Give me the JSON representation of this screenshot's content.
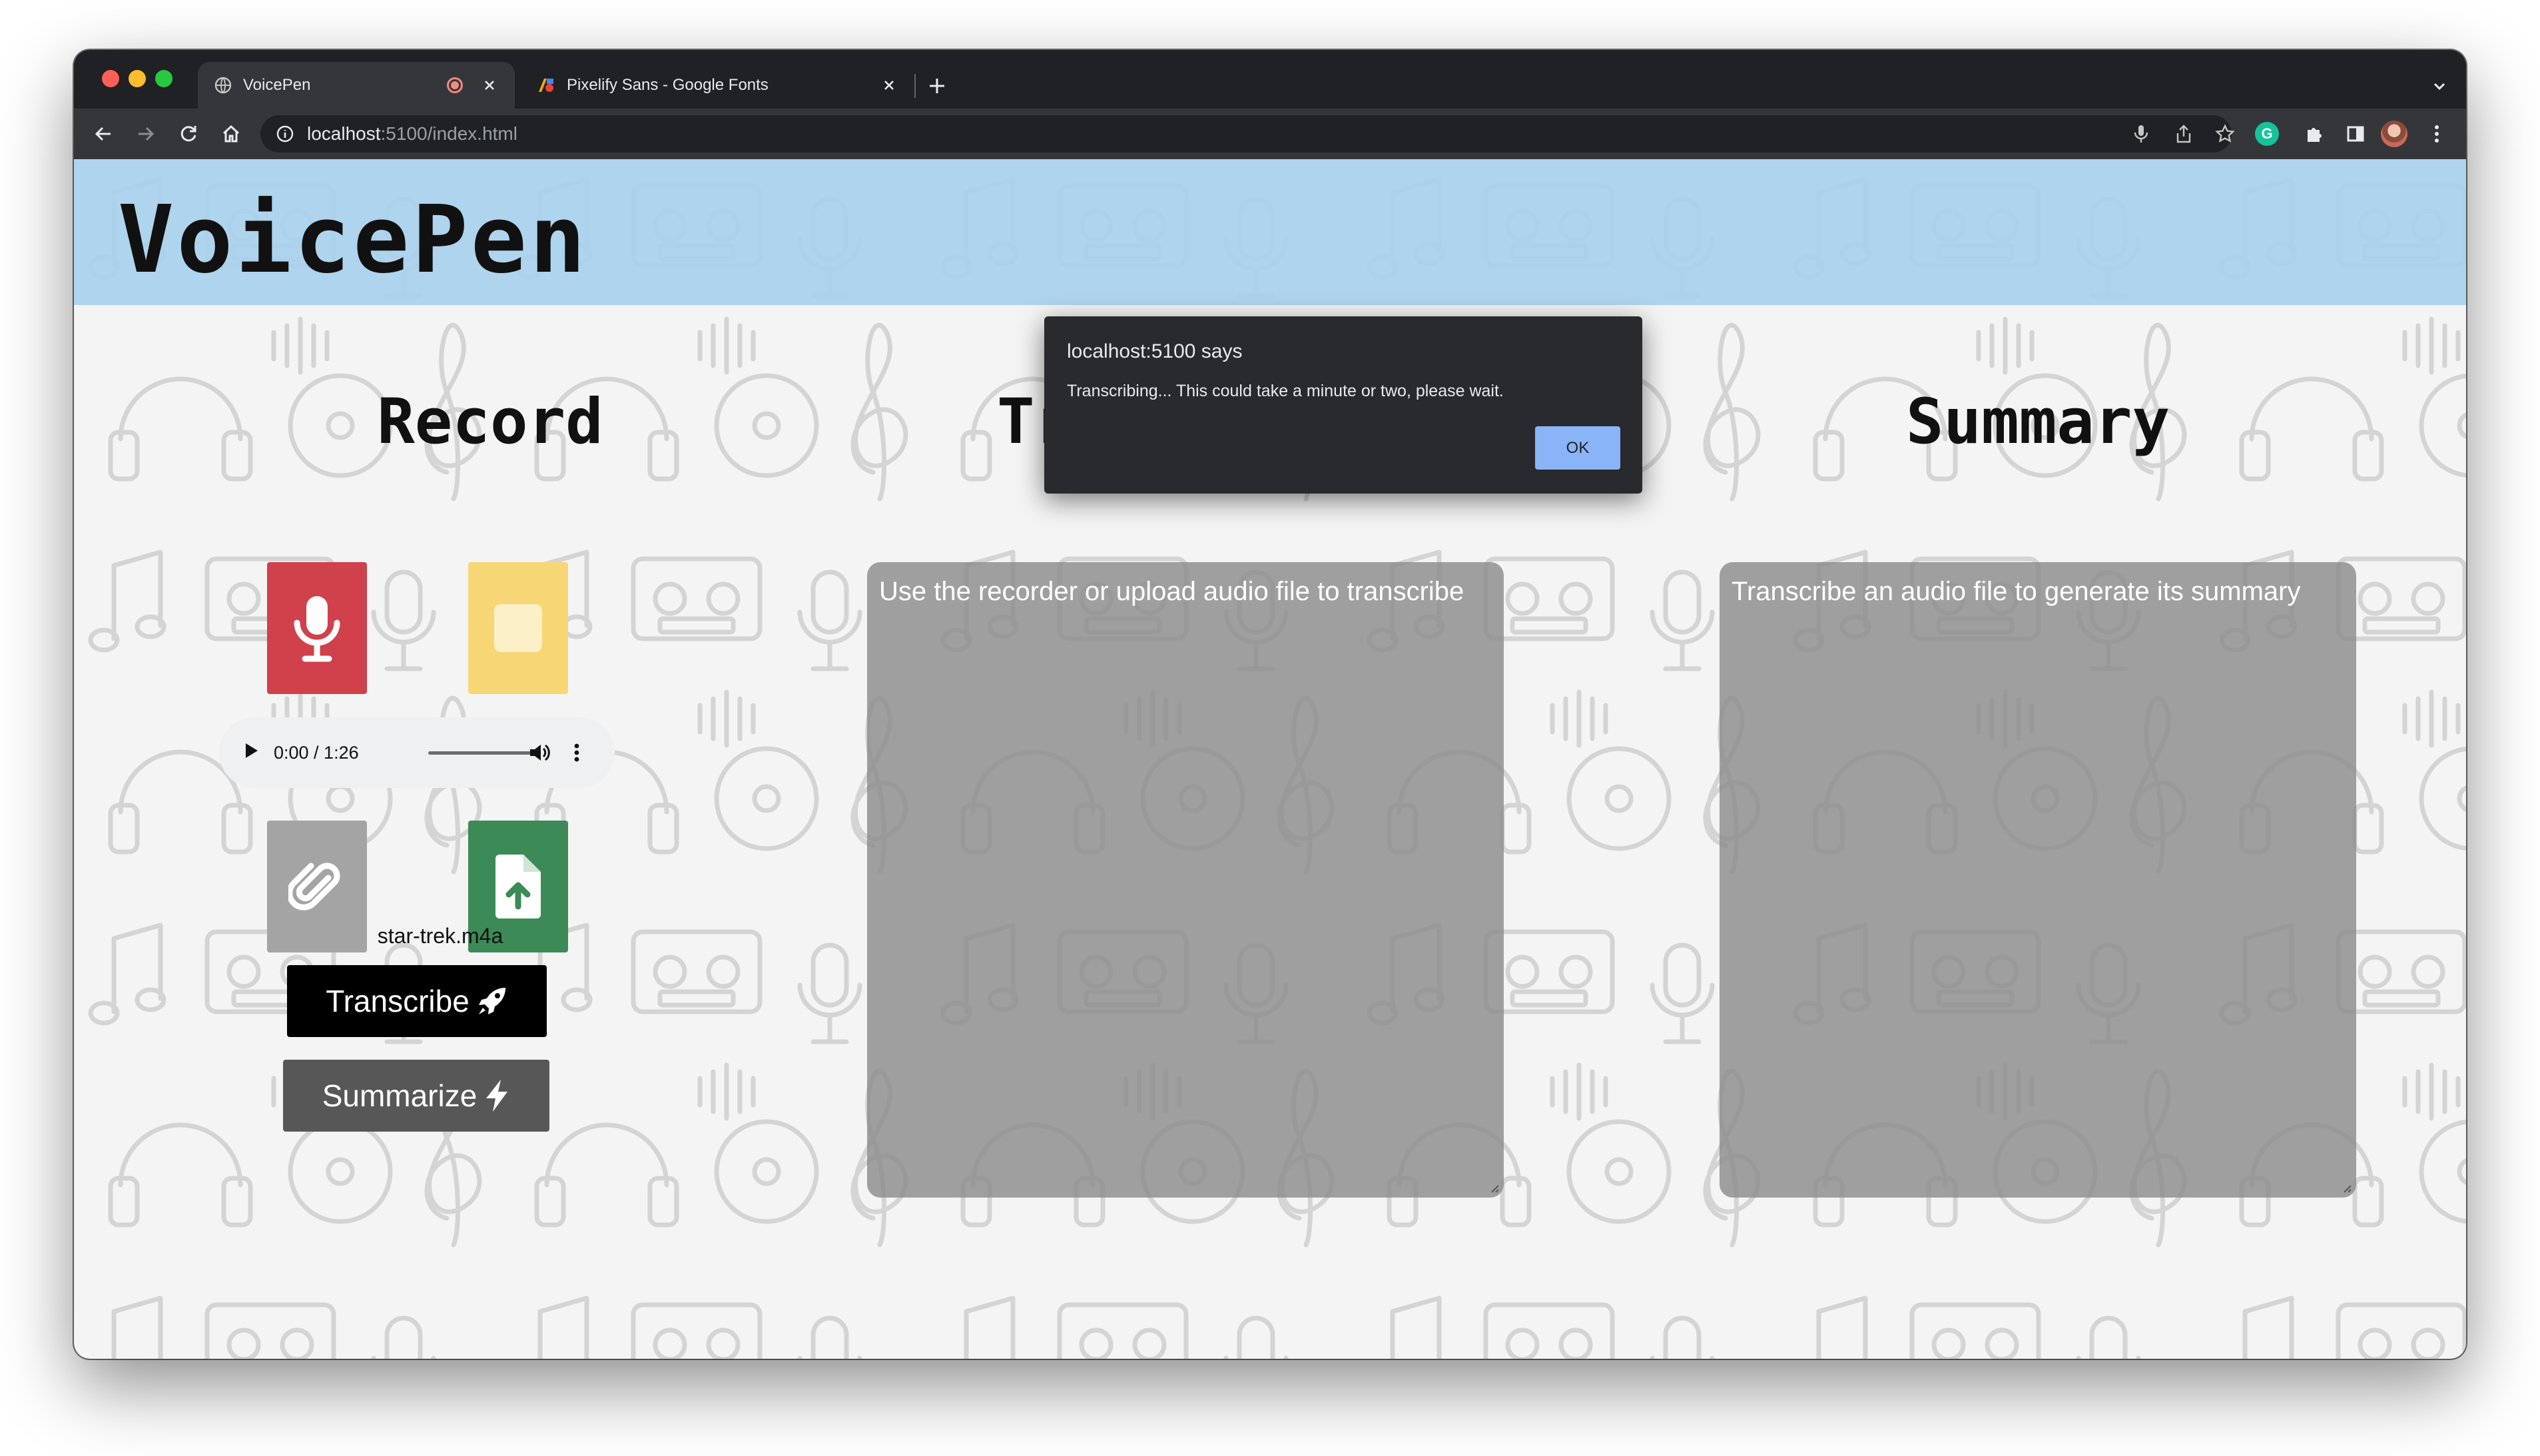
{
  "browser": {
    "tabs": [
      {
        "title": "VoicePen",
        "active": true,
        "recording": true
      },
      {
        "title": "Pixelify Sans - Google Fonts",
        "active": false
      }
    ],
    "url_host": "localhost",
    "url_path": ":5100/index.html",
    "extension_letter": "G"
  },
  "app": {
    "brand": "VoicePen",
    "sections": {
      "record": "Record",
      "transcript": "Transcript",
      "summary": "Summary"
    },
    "audio": {
      "time": "0:00 / 1:26"
    },
    "file_name": "star-trek.m4a",
    "transcribe_label": "Transcribe",
    "summarize_label": "Summarize",
    "transcript_placeholder": "Use the recorder or upload audio file to transcribe",
    "summary_placeholder": "Transcribe an audio file to generate its summary"
  },
  "dialog": {
    "title": "localhost:5100 says",
    "message": "Transcribing... This could take a minute or two, please wait.",
    "ok_label": "OK"
  },
  "colors": {
    "header": "#a8d0ec",
    "record_button": "#d0414b",
    "stop_button": "#f7d775",
    "attach_button": "#a4a4a4",
    "upload_button": "#3c8a56",
    "ok_button": "#8ab4f8"
  },
  "icons": [
    "globe-icon",
    "recording-dot-icon",
    "close-icon",
    "google-fonts-icon",
    "plus-icon",
    "chevron-down-icon",
    "back-icon",
    "forward-icon",
    "reload-icon",
    "home-icon",
    "info-icon",
    "microphone-icon",
    "share-icon",
    "star-icon",
    "puzzle-icon",
    "sidepanel-icon",
    "menu-dots-icon",
    "stop-icon",
    "play-icon",
    "volume-icon",
    "paperclip-icon",
    "file-upload-icon",
    "rocket-icon",
    "bolt-icon"
  ]
}
